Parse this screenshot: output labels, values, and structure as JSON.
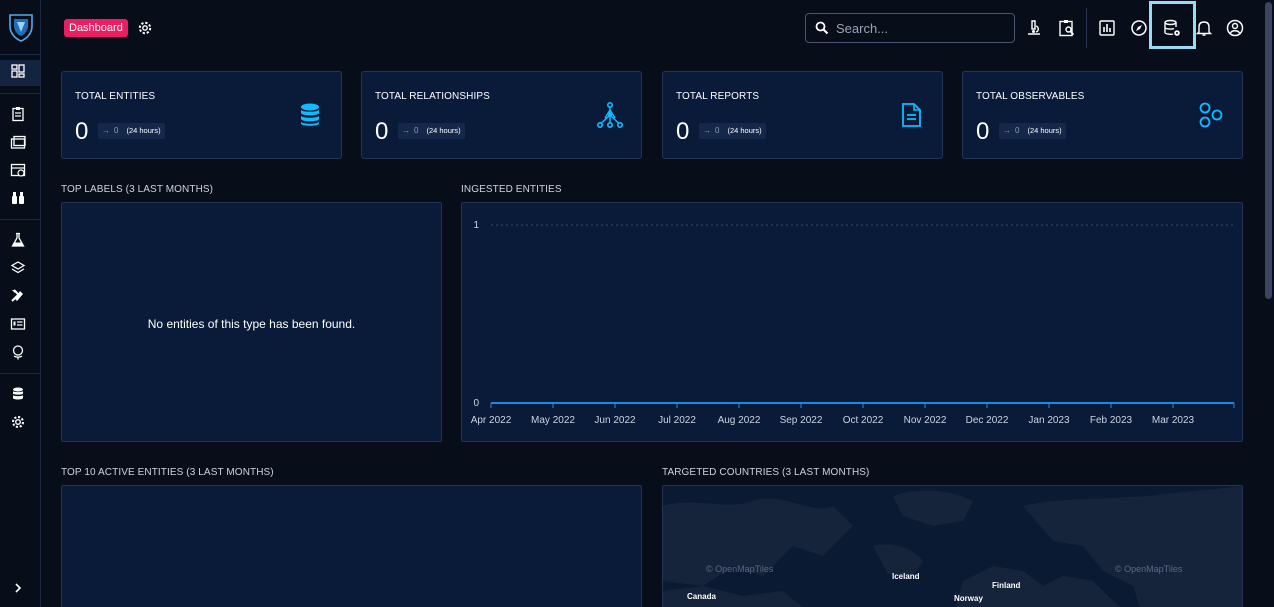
{
  "header": {
    "badge": "Dashboard",
    "search_placeholder": "Search..."
  },
  "cards": [
    {
      "title": "TOTAL ENTITIES",
      "value": "0",
      "delta": "0",
      "period": "(24 hours)",
      "icon": "database-icon"
    },
    {
      "title": "TOTAL RELATIONSHIPS",
      "value": "0",
      "delta": "0",
      "period": "(24 hours)",
      "icon": "graph-icon"
    },
    {
      "title": "TOTAL REPORTS",
      "value": "0",
      "delta": "0",
      "period": "(24 hours)",
      "icon": "document-icon"
    },
    {
      "title": "TOTAL OBSERVABLES",
      "value": "0",
      "delta": "0",
      "period": "(24 hours)",
      "icon": "hexagons-icon"
    }
  ],
  "top_labels": {
    "title": "TOP LABELS (3 LAST MONTHS)",
    "empty_message": "No entities of this type has been found."
  },
  "ingested": {
    "title": "INGESTED ENTITIES"
  },
  "chart_data": {
    "type": "area",
    "title": "",
    "categories": [
      "Apr 2022",
      "May 2022",
      "Jun 2022",
      "Jul 2022",
      "Aug 2022",
      "Sep 2022",
      "Oct 2022",
      "Nov 2022",
      "Dec 2022",
      "Jan 2023",
      "Feb 2023",
      "Mar 2023"
    ],
    "series": [
      {
        "values": [
          0,
          0,
          0,
          0,
          0,
          0,
          0,
          0,
          0,
          0,
          0,
          0
        ]
      }
    ],
    "ylim": [
      0,
      1
    ],
    "yticks": [
      "0",
      "1"
    ],
    "grid": true,
    "color": "#1e88e5"
  },
  "top_active": {
    "title": "TOP 10 ACTIVE ENTITIES (3 LAST MONTHS)"
  },
  "targeted": {
    "title": "TARGETED COUNTRIES (3 LAST MONTHS)",
    "map_labels": [
      "Iceland",
      "Finland",
      "Canada",
      "Norway"
    ],
    "credit": "© OpenMapTiles"
  },
  "colors": {
    "accent": "#0fbcff",
    "badge": "#e91e63",
    "panel": "#0a1b3a",
    "background": "#070d19"
  }
}
